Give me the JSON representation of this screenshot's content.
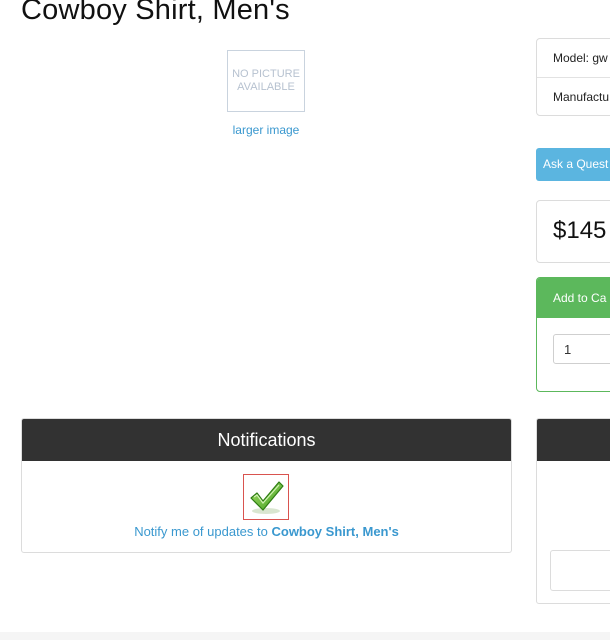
{
  "product": {
    "title": "Cowboy Shirt, Men's",
    "image_placeholder": "NO PICTURE AVAILABLE",
    "larger_image_link": "larger image"
  },
  "info": {
    "model_label": "Model: gw",
    "manufacturer_label": "Manufactu"
  },
  "ask_button": "Ask a Quest",
  "price": "$145",
  "cart": {
    "header": "Add to Ca",
    "quantity": "1"
  },
  "notifications": {
    "header": "Notifications",
    "text_prefix": "Notify me of updates to ",
    "product_name": "Cowboy Shirt, Men's",
    "icon": "checkmark-icon"
  },
  "colors": {
    "link": "#3a98cf",
    "ask_button": "#5bb5e0",
    "cart_green": "#5cb85c",
    "panel_header": "#323232",
    "check_border": "#d9534f"
  }
}
